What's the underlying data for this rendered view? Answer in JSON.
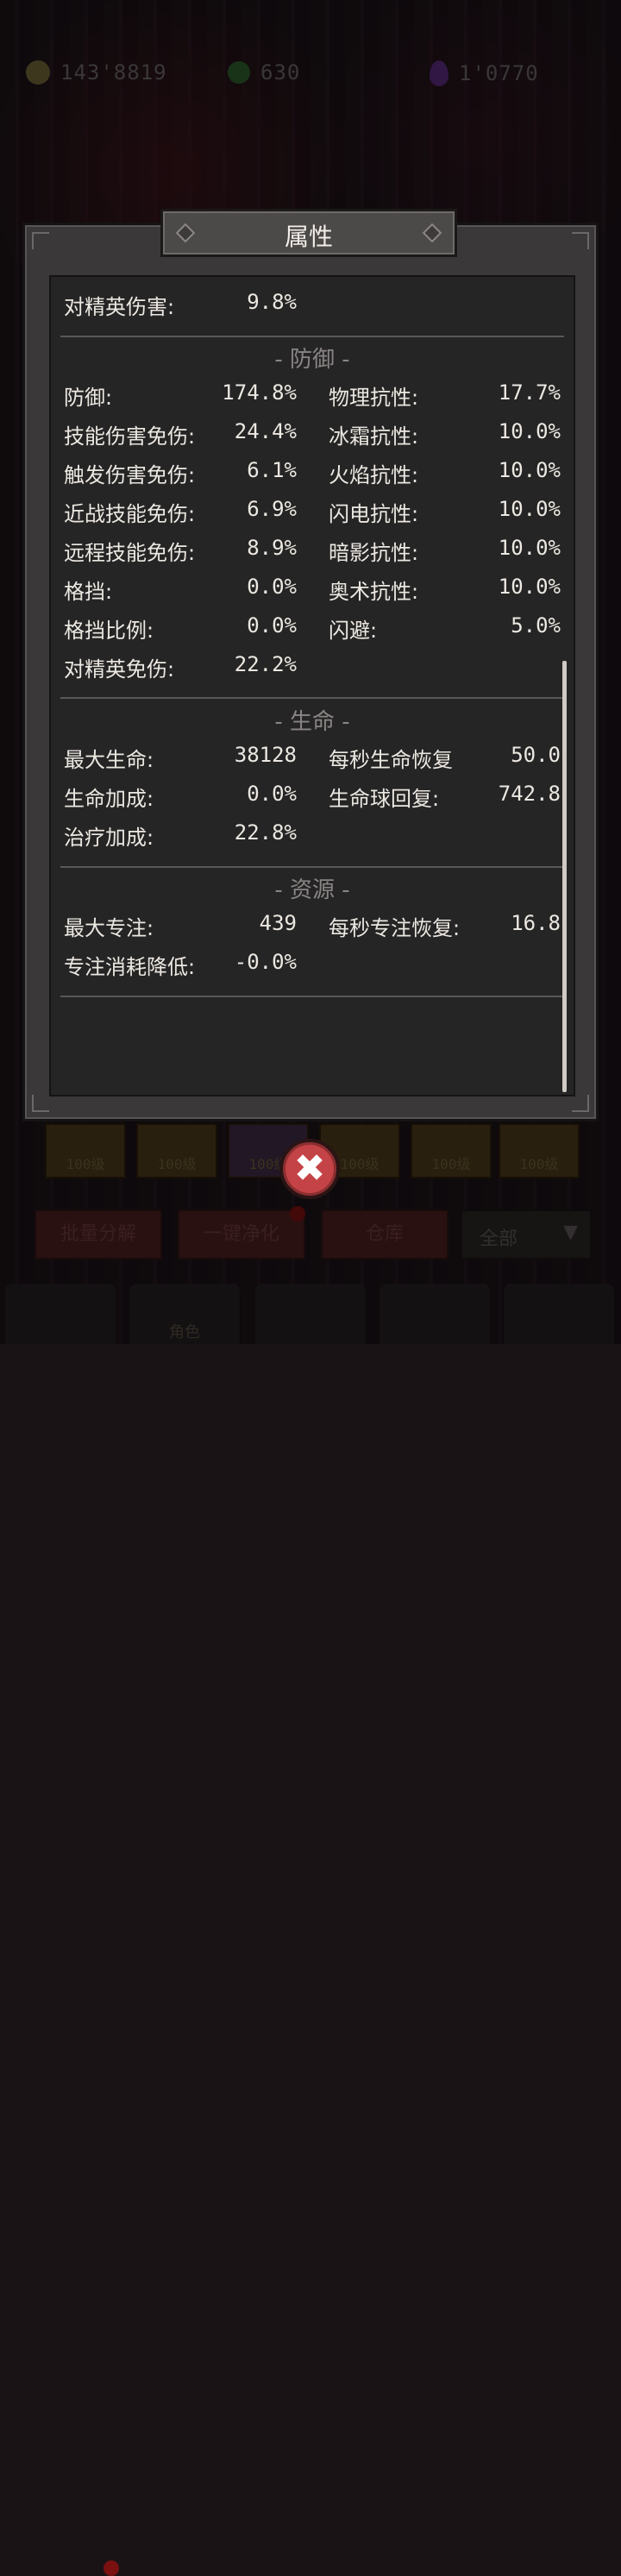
{
  "currencies": [
    {
      "icon": "gold-coin-icon",
      "amount": "143'8819"
    },
    {
      "icon": "green-gem-icon",
      "amount": "630"
    },
    {
      "icon": "purple-drop-icon",
      "amount": "1'0770"
    }
  ],
  "panel": {
    "title": "属性",
    "top_row": {
      "label": "对精英伤害:",
      "value": "9.8%"
    },
    "defense": {
      "title": "- 防御 -",
      "left": [
        {
          "label": "防御:",
          "value": "174.8%"
        },
        {
          "label": "技能伤害免伤:",
          "value": "24.4%"
        },
        {
          "label": "触发伤害免伤:",
          "value": "6.1%"
        },
        {
          "label": "近战技能免伤:",
          "value": "6.9%"
        },
        {
          "label": "远程技能免伤:",
          "value": "8.9%"
        },
        {
          "label": "格挡:",
          "value": "0.0%"
        },
        {
          "label": "格挡比例:",
          "value": "0.0%"
        },
        {
          "label": "对精英免伤:",
          "value": "22.2%"
        }
      ],
      "right": [
        {
          "label": "物理抗性:",
          "value": "17.7%"
        },
        {
          "label": "冰霜抗性:",
          "value": "10.0%"
        },
        {
          "label": "火焰抗性:",
          "value": "10.0%"
        },
        {
          "label": "闪电抗性:",
          "value": "10.0%"
        },
        {
          "label": "暗影抗性:",
          "value": "10.0%"
        },
        {
          "label": "奥术抗性:",
          "value": "10.0%"
        },
        {
          "label": "闪避:",
          "value": "5.0%"
        }
      ]
    },
    "life": {
      "title": "- 生命 -",
      "left": [
        {
          "label": "最大生命:",
          "value": "38128"
        },
        {
          "label": "生命加成:",
          "value": "0.0%"
        },
        {
          "label": "治疗加成:",
          "value": "22.8%"
        }
      ],
      "right": [
        {
          "label": "每秒生命恢复",
          "value": "50.0"
        },
        {
          "label": "生命球回复:",
          "value": "742.8"
        }
      ]
    },
    "resource": {
      "title": "- 资源 -",
      "left": [
        {
          "label": "最大专注:",
          "value": "439"
        },
        {
          "label": "专注消耗降低:",
          "value": "-0.0%"
        }
      ],
      "right": [
        {
          "label": "每秒专注恢复:",
          "value": "16.8"
        }
      ]
    }
  },
  "inventory": {
    "slots": [
      "100级",
      "100级",
      "100级",
      "100级",
      "100级",
      "100级"
    ]
  },
  "actions": {
    "batch_decompose": "批量分解",
    "one_click_purify": "一键净化",
    "warehouse": "仓库",
    "filter": "全部"
  },
  "nav": {
    "character_label": "角色"
  },
  "colors": {
    "panel_bg": "#3a3838",
    "close_button": "#c44346"
  }
}
